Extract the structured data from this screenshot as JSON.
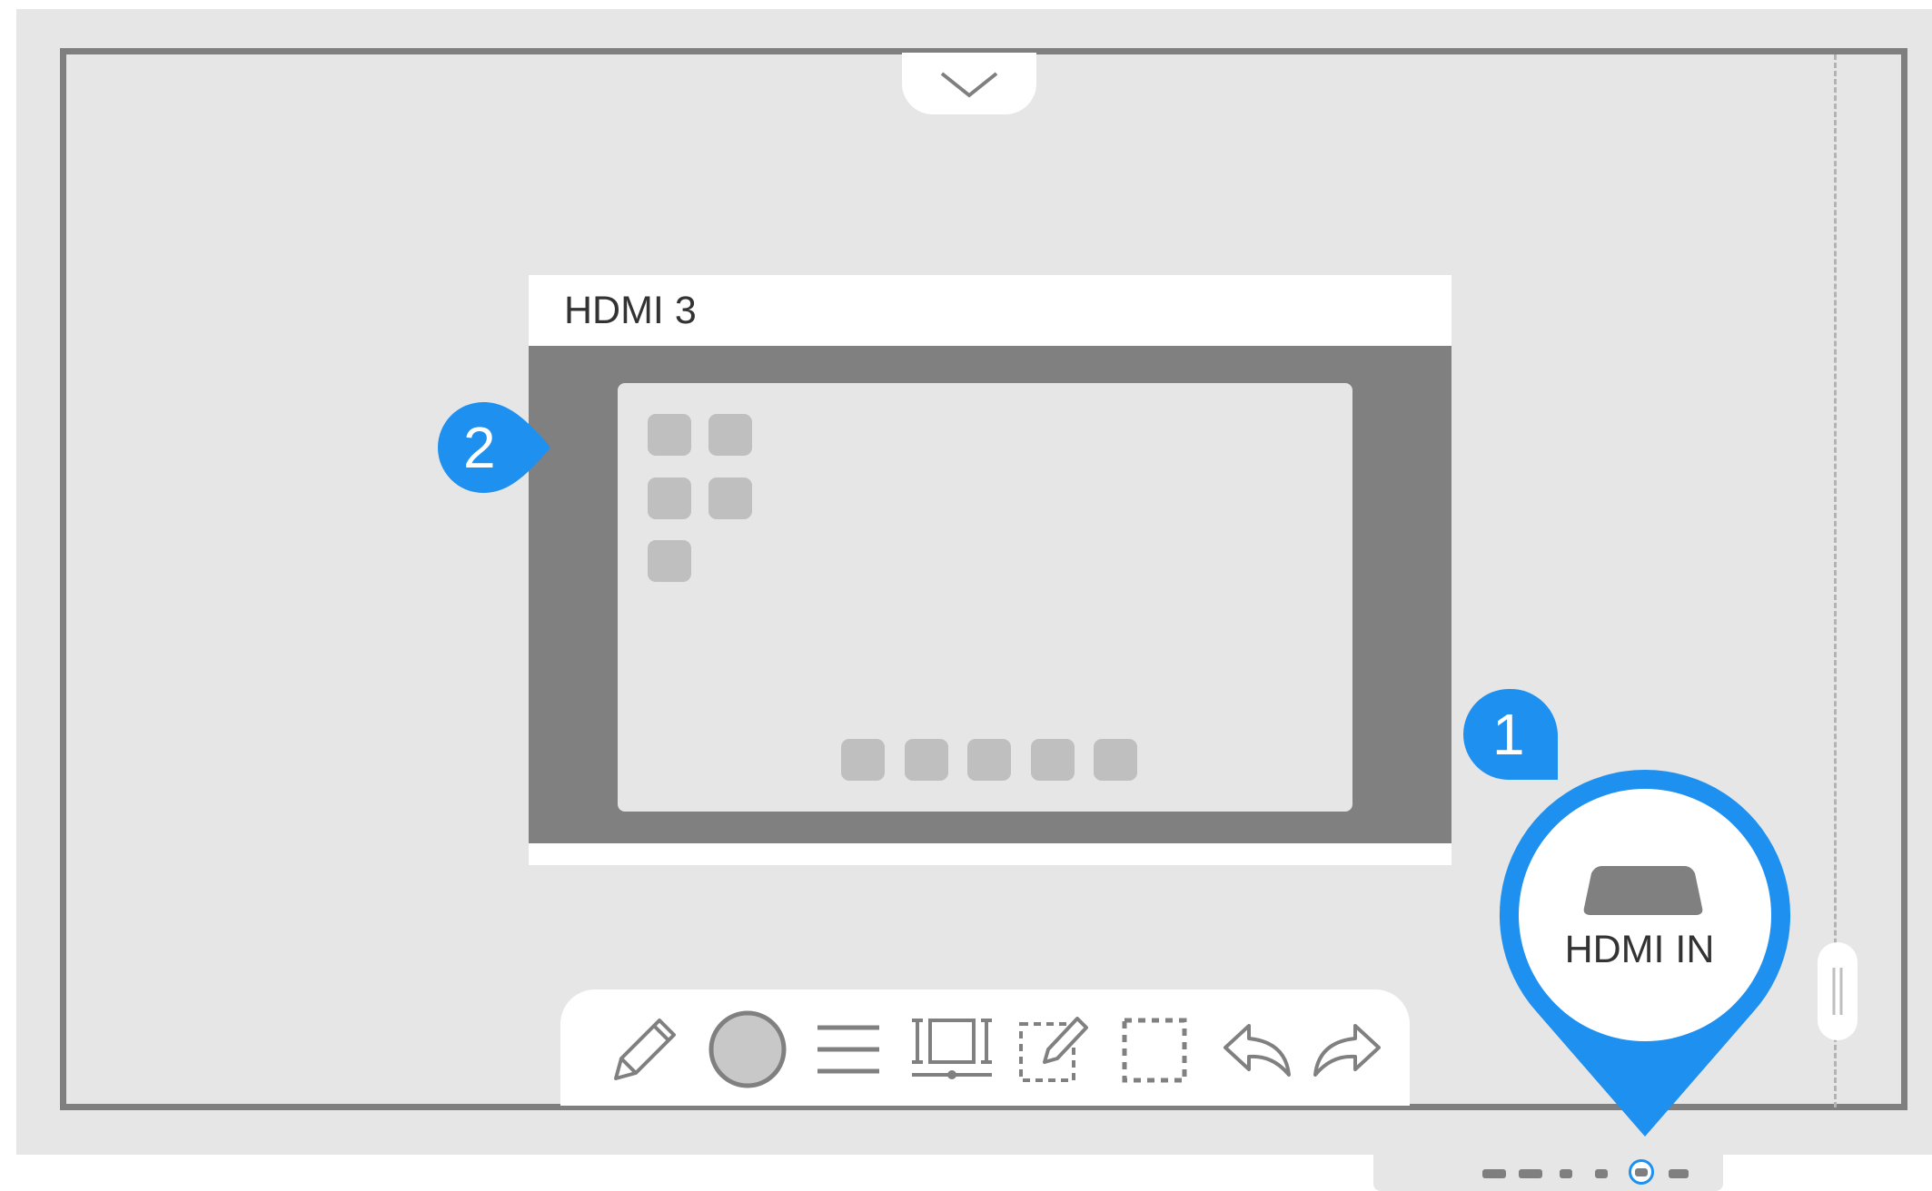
{
  "preview": {
    "title": "HDMI 3",
    "app_grid_icons": [
      "app-icon",
      "app-icon",
      "app-icon",
      "app-icon",
      "app-icon"
    ],
    "dock_icons": [
      "app-icon",
      "app-icon",
      "app-icon",
      "app-icon",
      "app-icon"
    ]
  },
  "callouts": {
    "one": "1",
    "two": "2",
    "color": "#1e90f0"
  },
  "hdmi_source": {
    "label": "HDMI IN",
    "icon": "hdmi-port-icon"
  },
  "toolbar": {
    "tools": [
      {
        "name": "pen-tool",
        "icon": "pencil-icon"
      },
      {
        "name": "color-picker",
        "icon": "circle-icon"
      },
      {
        "name": "menu-tool",
        "icon": "lines-icon"
      },
      {
        "name": "width-tool",
        "icon": "width-adjust-icon"
      },
      {
        "name": "edit-tool",
        "icon": "edit-note-icon"
      },
      {
        "name": "select-tool",
        "icon": "dashed-select-icon"
      },
      {
        "name": "undo-button",
        "icon": "undo-icon"
      },
      {
        "name": "redo-button",
        "icon": "redo-icon"
      }
    ]
  },
  "page_indicator": {
    "count": 6,
    "active_index": 4
  },
  "colors": {
    "accent": "#1e90f0",
    "bezel": "#7f7f7f",
    "background": "#e6e6e6"
  }
}
